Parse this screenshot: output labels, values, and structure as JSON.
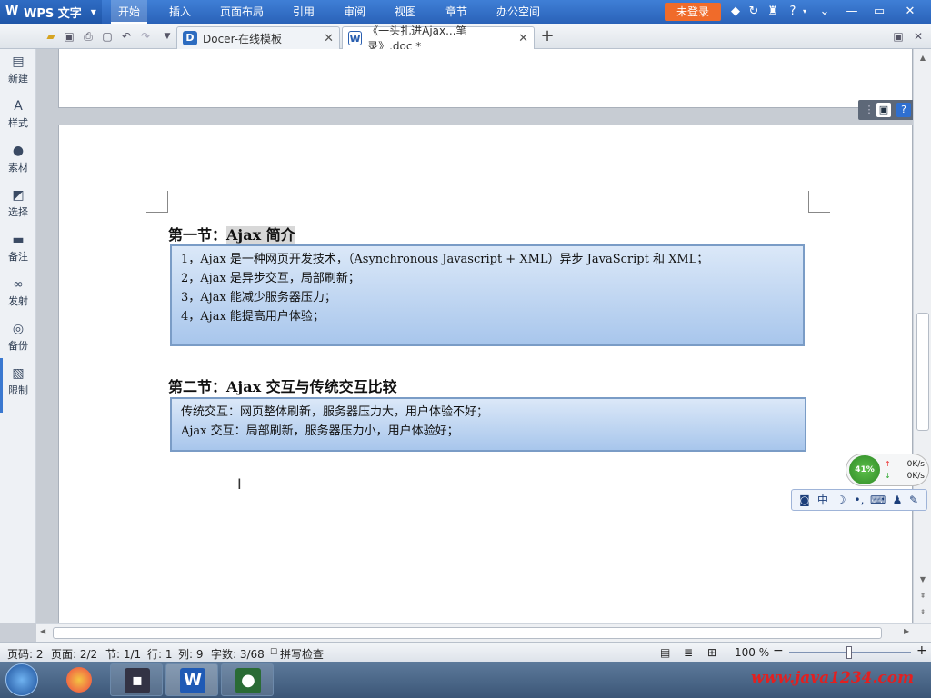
{
  "titlebar": {
    "app_name": "WPS 文字",
    "menu_tabs": [
      "开始",
      "插入",
      "页面布局",
      "引用",
      "审阅",
      "视图",
      "章节",
      "办公空间"
    ],
    "login_label": "未登录",
    "icons": [
      "diamond-icon",
      "refresh-icon",
      "shirt-icon",
      "help-icon",
      "chevron-down-icon",
      "minimize-icon",
      "maximize-icon",
      "close-icon"
    ]
  },
  "tabs": [
    {
      "title": "Docer-在线模板",
      "icon": "docer-icon"
    },
    {
      "title": "《一头扎进Ajax...笔录》.doc *",
      "icon": "word-doc-icon"
    }
  ],
  "sidebar": {
    "items": [
      {
        "label": "新建",
        "icon": "new-doc-icon"
      },
      {
        "label": "样式",
        "icon": "style-icon"
      },
      {
        "label": "素材",
        "icon": "material-icon"
      },
      {
        "label": "选择",
        "icon": "select-icon"
      },
      {
        "label": "备注",
        "icon": "comment-icon"
      },
      {
        "label": "发射",
        "icon": "link-icon"
      },
      {
        "label": "备份",
        "icon": "backup-icon"
      },
      {
        "label": "限制",
        "icon": "restrict-icon"
      }
    ]
  },
  "document": {
    "section1": {
      "title_prefix": "第一节：",
      "title_highlight": "Ajax 简介",
      "lines": [
        "1，Ajax 是一种网页开发技术，（Asynchronous Javascript + XML）异步 JavaScript 和 XML；",
        "2，Ajax 是异步交互，局部刷新；",
        "3，Ajax 能减少服务器压力；",
        "4，Ajax 能提高用户体验；"
      ]
    },
    "section2": {
      "title": "第二节：Ajax 交互与传统交互比较",
      "lines": [
        "传统交互：网页整体刷新，服务器压力大，用户体验不好；",
        "Ajax 交互：局部刷新，服务器压力小，用户体验好；"
      ]
    }
  },
  "netwidget": {
    "percent": "41%",
    "up_rate": "0K/s",
    "down_rate": "0K/s"
  },
  "imebar": {
    "chinese_mode": "中"
  },
  "statusbar": {
    "page_num": "页码: 2",
    "pages": "页面: 2/2",
    "section": "节: 1/1",
    "line": "行: 1",
    "column": "列: 9",
    "word_count": "字数: 3/68",
    "spell_check": "拼写检查",
    "zoom": "100 %"
  },
  "watermark": "www.java1234.com",
  "colors": {
    "titlebar": "#2a62b8",
    "login_button": "#f06b2a",
    "box_border": "#7a9cc6",
    "box_fill": "#a8c6ec",
    "watermark": "#e32020"
  }
}
